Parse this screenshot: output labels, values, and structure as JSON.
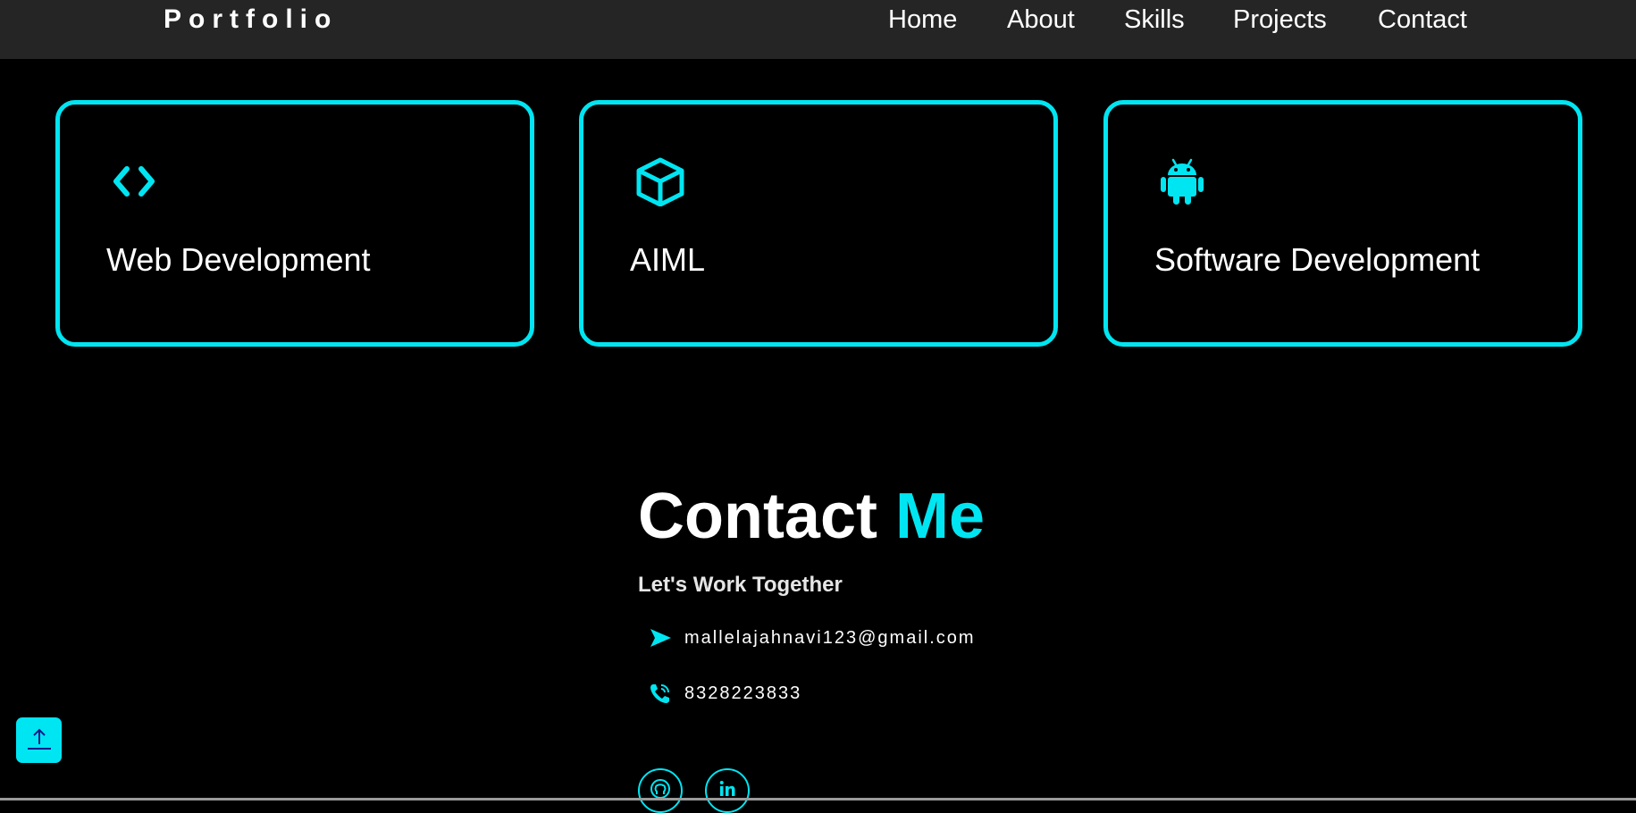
{
  "navbar": {
    "brand": "Portfolio",
    "links": [
      "Home",
      "About",
      "Skills",
      "Projects",
      "Contact"
    ]
  },
  "services": [
    {
      "title": "Web Development",
      "icon": "code-icon"
    },
    {
      "title": "AIML",
      "icon": "cube-icon"
    },
    {
      "title": "Software Development",
      "icon": "android-icon"
    }
  ],
  "contact": {
    "title_main": "Contact",
    "title_accent": "Me",
    "subtitle": "Let's Work Together",
    "email": "mallelajahnavi123@gmail.com",
    "phone": "8328223833",
    "socials": [
      "github-icon",
      "linkedin-icon"
    ]
  },
  "back_to_top": {
    "icon": "arrow-up-icon"
  },
  "colors": {
    "accent": "#00e5f2",
    "background": "#000000",
    "navbar": "#252525",
    "text": "#ffffff"
  }
}
